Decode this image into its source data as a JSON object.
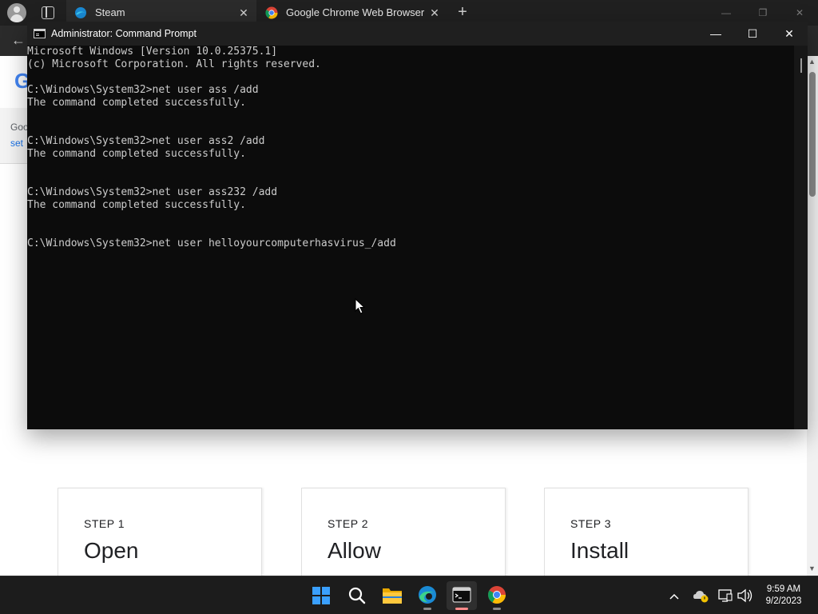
{
  "browser": {
    "tabs": [
      {
        "title": "Steam",
        "icon": "edge-icon"
      },
      {
        "title": "Google Chrome Web Browser",
        "icon": "chrome-icon"
      }
    ],
    "new_tab_symbol": "+",
    "close_symbol": "✕",
    "window_controls": {
      "minimize": "—",
      "restore": "❐",
      "close": "✕"
    },
    "back_symbol": "←"
  },
  "page": {
    "logo_letter": "G",
    "header_line1": "Goo",
    "header_line2": "set",
    "steps": [
      {
        "number": "STEP 1",
        "title": "Open"
      },
      {
        "number": "STEP 2",
        "title": "Allow"
      },
      {
        "number": "STEP 3",
        "title": "Install"
      }
    ]
  },
  "cmd": {
    "title": "Administrator: Command Prompt",
    "controls": {
      "minimize": "—",
      "maximize": "☐",
      "close": "✕"
    },
    "lines": [
      "Microsoft Windows [Version 10.0.25375.1]",
      "(c) Microsoft Corporation. All rights reserved.",
      "",
      "C:\\Windows\\System32>net user ass /add",
      "The command completed successfully.",
      "",
      "",
      "C:\\Windows\\System32>net user ass2 /add",
      "The command completed successfully.",
      "",
      "",
      "C:\\Windows\\System32>net user ass232 /add",
      "The command completed successfully.",
      "",
      ""
    ],
    "current_input_before_cursor": "C:\\Windows\\System32>net user helloyourcomputerhasvirus",
    "cursor": "_",
    "current_input_after_cursor": "/add"
  },
  "taskbar": {
    "apps": [
      {
        "name": "start-button",
        "icon": "windows-logo-icon"
      },
      {
        "name": "search-button",
        "icon": "search-icon"
      },
      {
        "name": "file-explorer-button",
        "icon": "folder-icon"
      },
      {
        "name": "edge-button",
        "icon": "edge-icon"
      },
      {
        "name": "terminal-button",
        "icon": "terminal-icon"
      },
      {
        "name": "chrome-button",
        "icon": "chrome-icon"
      }
    ],
    "tray": {
      "chevron": "^",
      "time": "9:59 AM",
      "date": "9/2/2023"
    }
  }
}
